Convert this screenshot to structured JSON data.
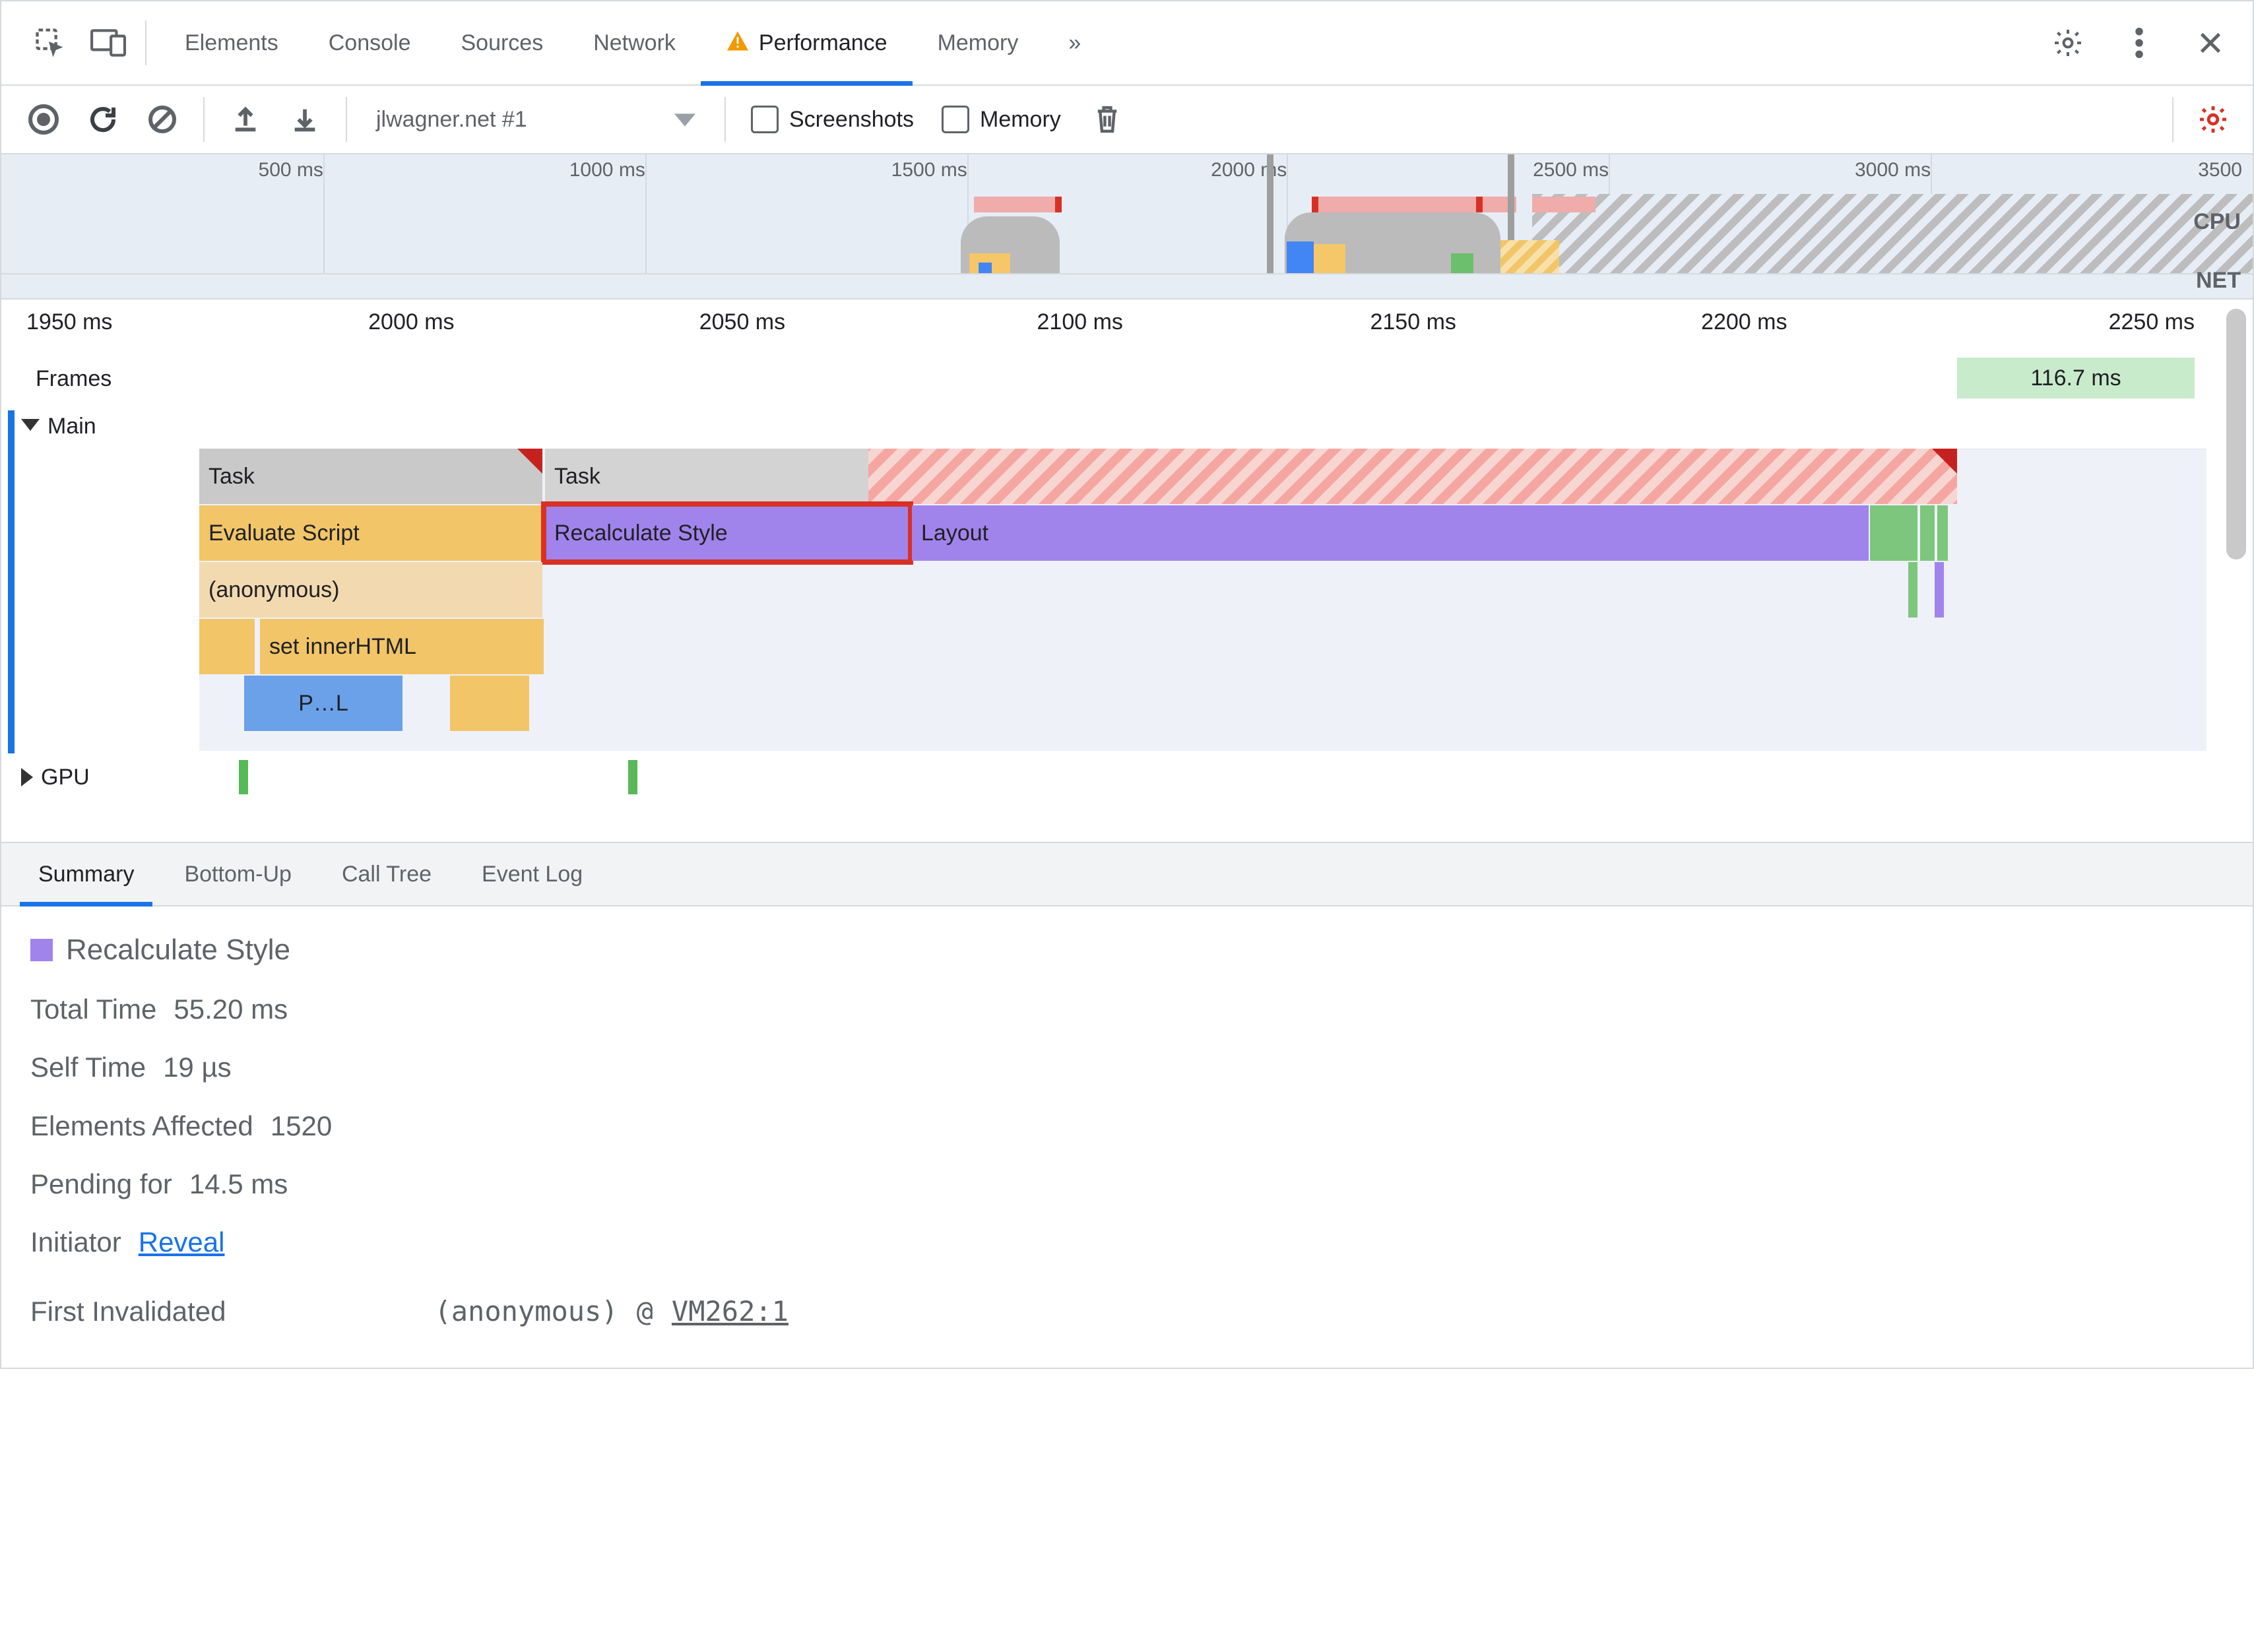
{
  "tabs": {
    "items": [
      "Elements",
      "Console",
      "Sources",
      "Network",
      "Performance",
      "Memory"
    ],
    "active_index": 4,
    "has_warning_on_active": true,
    "overflow_glyph": "»"
  },
  "toolbar": {
    "recording_label": "jlwagner.net #1",
    "checkbox_screenshots": "Screenshots",
    "checkbox_memory": "Memory"
  },
  "overview": {
    "ruler_ticks_ms": [
      500,
      1000,
      1500,
      2000,
      2500,
      3000
    ],
    "ruler_right_label": "3500",
    "unit_suffix": " ms",
    "cpu_label": "CPU",
    "net_label": "NET"
  },
  "detail": {
    "ruler_ticks": [
      "1950 ms",
      "2000 ms",
      "2050 ms",
      "2100 ms",
      "2150 ms",
      "2200 ms",
      "2250 ms"
    ],
    "frames_label": "Frames",
    "frame_duration": "116.7 ms",
    "main_label": "Main",
    "gpu_label": "GPU",
    "rows": {
      "task1": "Task",
      "task2": "Task",
      "evaluate_script": "Evaluate Script",
      "recalculate_style": "Recalculate Style",
      "layout": "Layout",
      "anonymous": "(anonymous)",
      "set_innerhtml": "set innerHTML",
      "truncated": "P…L"
    }
  },
  "subtabs": {
    "items": [
      "Summary",
      "Bottom-Up",
      "Call Tree",
      "Event Log"
    ],
    "active_index": 0
  },
  "summary": {
    "title": "Recalculate Style",
    "rows": [
      {
        "k": "Total Time",
        "v": "55.20 ms"
      },
      {
        "k": "Self Time",
        "v": "19 µs"
      },
      {
        "k": "Elements Affected",
        "v": "1520"
      },
      {
        "k": "Pending for",
        "v": "14.5 ms"
      }
    ],
    "initiator_label": "Initiator",
    "initiator_link": "Reveal",
    "first_invalidated_label": "First Invalidated",
    "stack_fn": "(anonymous)",
    "stack_at": "@",
    "stack_loc": "VM262:1"
  }
}
